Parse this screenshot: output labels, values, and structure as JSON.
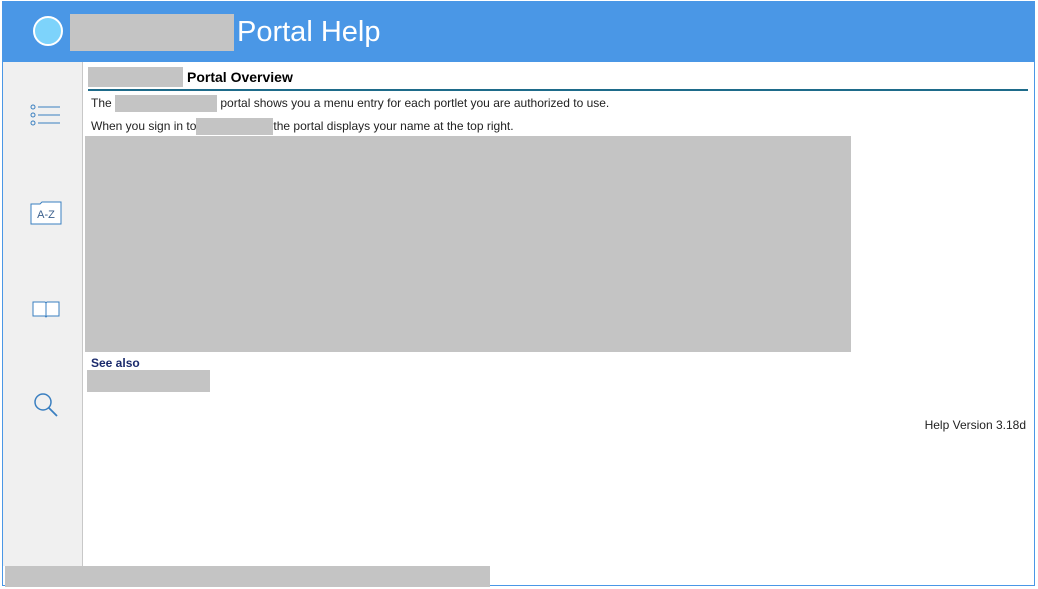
{
  "header": {
    "title": "Portal Help"
  },
  "sidebar": {
    "items": [
      {
        "icon": "toc-list-icon"
      },
      {
        "icon": "index-az-icon",
        "label": "A-Z"
      },
      {
        "icon": "open-book-icon"
      },
      {
        "icon": "search-icon"
      }
    ]
  },
  "content": {
    "title": "Portal Overview",
    "para1_start": "The",
    "para1_end": "portal shows you a menu entry for each portlet you are authorized to use.",
    "para2_start": "When you sign in to",
    "para2_end": "the portal displays your name at the top right.",
    "see_also": "See also",
    "version": "Help Version 3.18d"
  },
  "colors": {
    "header_bg": "#4a97e6",
    "logo_circle": "#7dd3fb",
    "title_rule": "#1e6b8a",
    "see_also_text": "#1a2a6c",
    "redaction": "#c4c4c4"
  }
}
